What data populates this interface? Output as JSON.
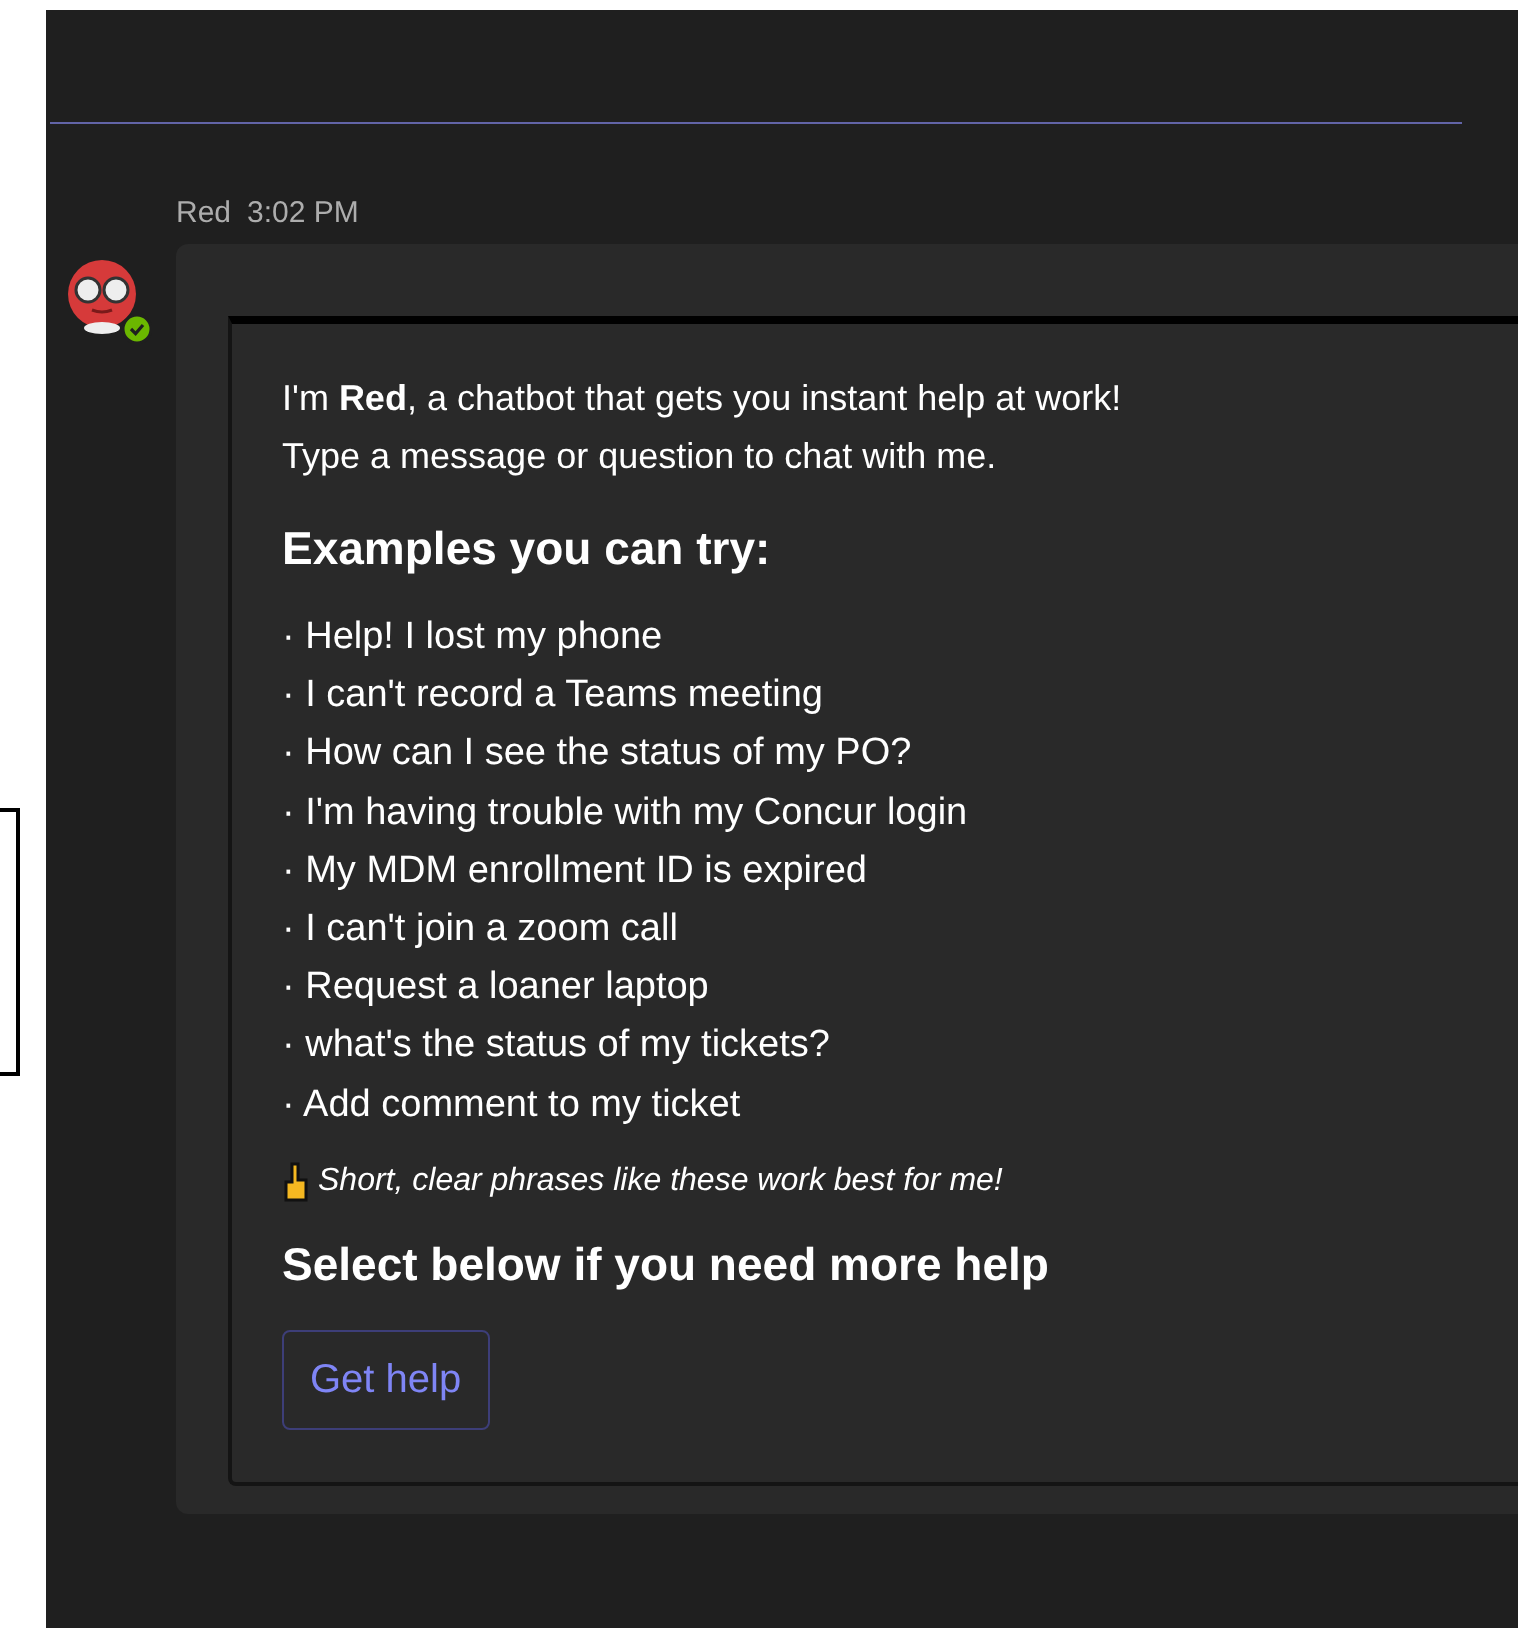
{
  "message": {
    "sender": "Red",
    "time": "3:02 PM",
    "online": true,
    "intro": [
      "I'm **Red**, a chatbot that gets you instant help at work!",
      "Type a message or question to chat with me."
    ],
    "examples_heading": "Examples you can try:",
    "examples": [
      "· Help! I lost my phone",
      "· I can't record a Teams meeting",
      "· How can I see the status of my PO?",
      "· I'm having trouble with my Concur login",
      "· My MDM enrollment ID is expired",
      "· I can't join a zoom call",
      "· Request a loaner laptop",
      "· what's the status of my tickets?",
      "· Add comment to my ticket"
    ],
    "tip": "Short, clear phrases like these work best for me!",
    "help_heading": "Select below if you need more help",
    "button": "Get help"
  }
}
